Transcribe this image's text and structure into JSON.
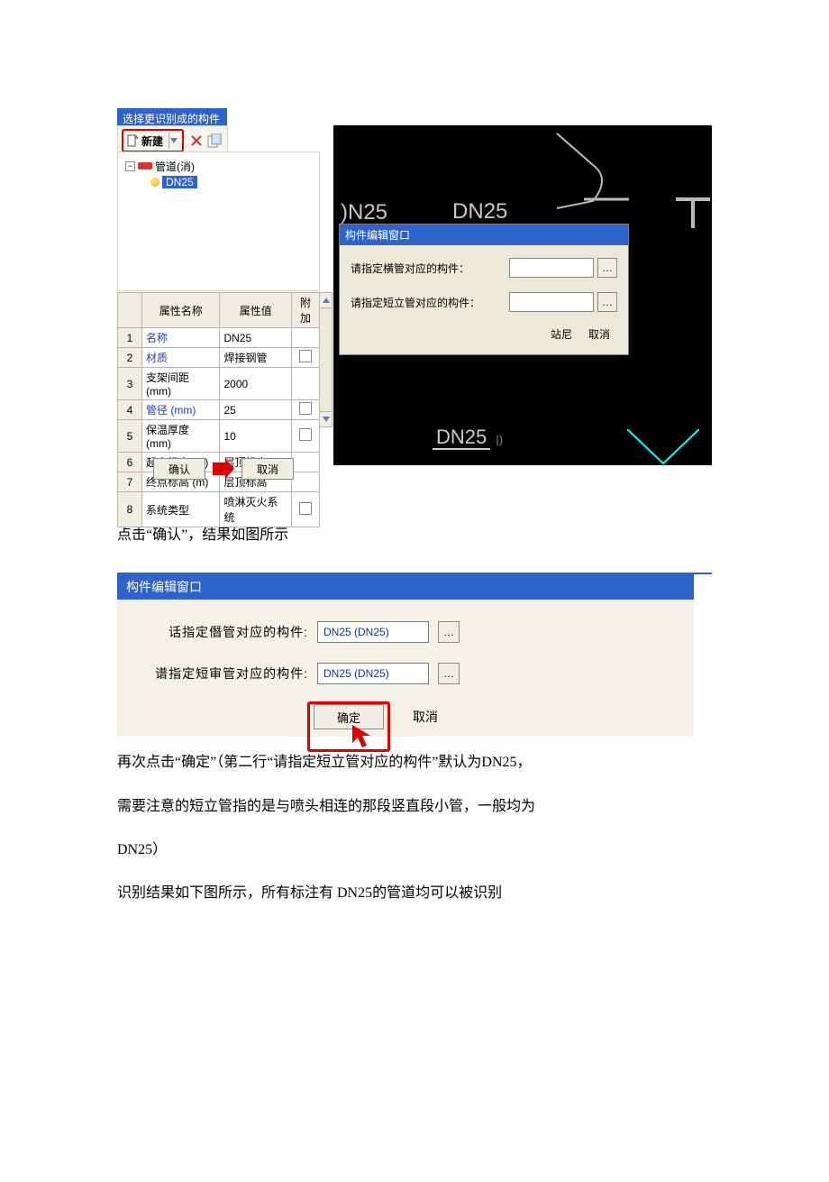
{
  "shot1": {
    "titlebar": "选择更识别成的构件",
    "toolbar": {
      "new_label": "新建"
    },
    "tree": {
      "root": "管道(消)",
      "child": "DN25"
    },
    "attr_headers": {
      "name": "属性名称",
      "value": "属性值",
      "add": "附加"
    },
    "attrs": [
      {
        "n": "1",
        "name": "名称",
        "value": "DN25",
        "chk": null,
        "hl": true
      },
      {
        "n": "2",
        "name": "材质",
        "value": "焊接钢管",
        "chk": false,
        "hl": true
      },
      {
        "n": "3",
        "name": "支架间距 (mm)",
        "value": "2000",
        "chk": null,
        "hl": false
      },
      {
        "n": "4",
        "name": "管径 (mm)",
        "value": "25",
        "chk": false,
        "hl": true
      },
      {
        "n": "5",
        "name": "保温厚度 (mm)",
        "value": "10",
        "chk": false,
        "hl": false
      },
      {
        "n": "6",
        "name": "起点标高 (m)",
        "value": "层顶标高",
        "chk": null,
        "hl": false
      },
      {
        "n": "7",
        "name": "终点标高 (m)",
        "value": "层顶标高",
        "chk": null,
        "hl": false
      },
      {
        "n": "8",
        "name": "系统类型",
        "value": "喷淋灭火系统",
        "chk": false,
        "hl": false
      }
    ],
    "ok": "确认",
    "cancel": "取消",
    "viewport": {
      "dn25a": ")N25",
      "dn25b": "DN25",
      "dn25c": "DN25"
    },
    "dlg": {
      "title": "构件编辑窗口",
      "row1": "请指定横管对应的构件：",
      "row2": "请指定短立管对应的构件：",
      "ok_like": "站尼",
      "cancel": "取消"
    }
  },
  "para1": "点击“确认”，结果如图所示",
  "shot2": {
    "title": "构件编辑窗口",
    "row1_label": "话指定僭管对应的构件:",
    "row2_label": "谱指定短审管对应的构件:",
    "val1": "DN25 (DN25)",
    "val2": "DN25 (DN25)",
    "ok": "确定",
    "cancel": "取消"
  },
  "body": {
    "p1": "再次点击“确定”（第二行“请指定短立管对应的构件”默认为DN25，",
    "p2": "需要注意的短立管指的是与喷头相连的那段竖直段小管，一般均为",
    "p3": "DN25）",
    "p4": "识别结果如下图所示，所有标注有 DN25的管道均可以被识别"
  }
}
